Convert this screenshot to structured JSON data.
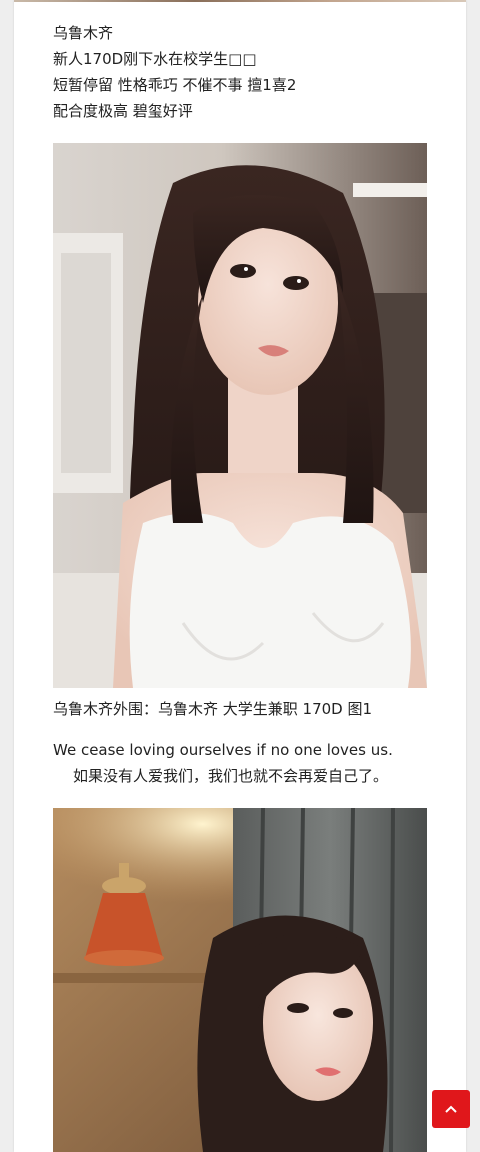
{
  "article": {
    "city": "乌鲁木齐",
    "line1": "新人170D刚下水在校学生□□",
    "line2": "短暂停留 性格乖巧 不催不事 擅1喜2",
    "line3": "配合度极高 碧玺好评",
    "caption": "乌鲁木齐外围：乌鲁木齐 大学生兼职 170D 图1",
    "quote_en": "We cease loving ourselves if no one loves us.",
    "quote_zh": "如果没有人爱我们，我们也就不会再爱自己了。"
  },
  "colors": {
    "accent": "#e0171b",
    "page_bg": "#eeeeee",
    "card_bg": "#ffffff",
    "text": "#222222"
  },
  "scroll_top": {
    "icon": "chevron-up-icon"
  }
}
